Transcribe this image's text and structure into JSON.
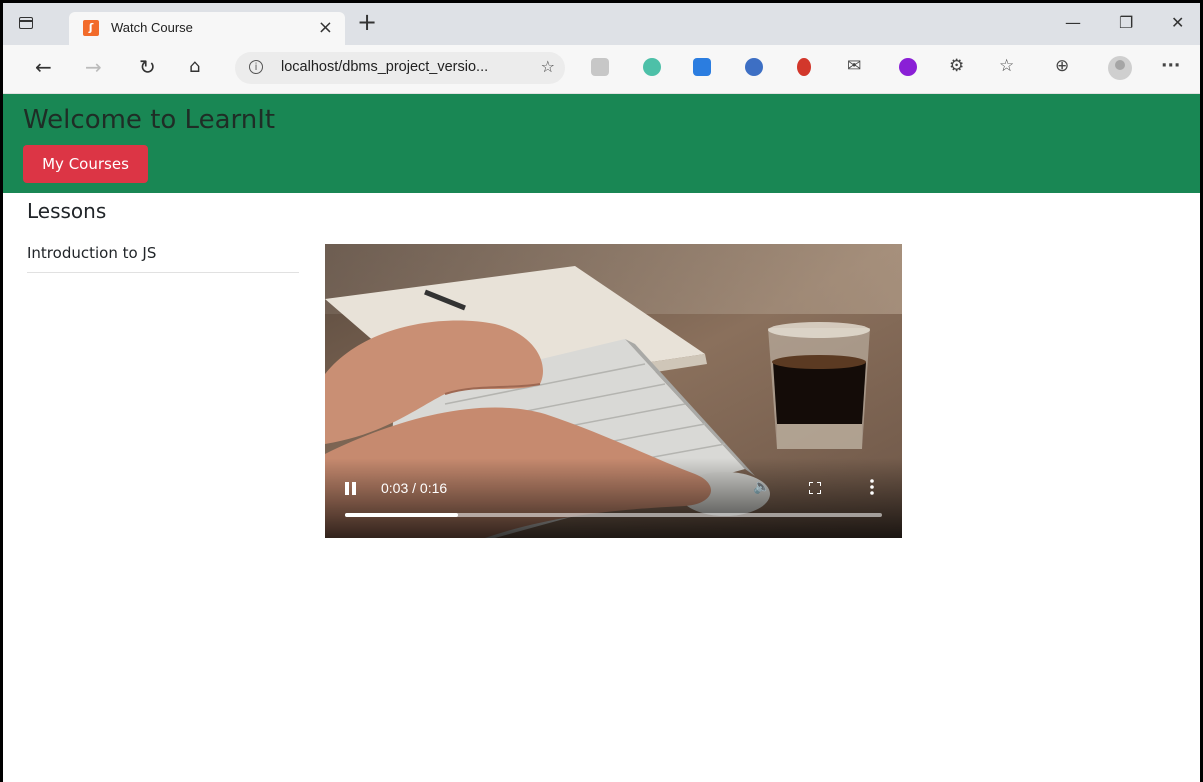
{
  "browser": {
    "tab_title": "Watch Course",
    "tab_close": "×",
    "new_tab": "+",
    "url": "localhost/dbms_project_versio...",
    "window_minimize": "—",
    "window_restore": "❐",
    "window_close": "✕"
  },
  "header": {
    "title": "Welcome to LearnIt",
    "my_courses_label": "My Courses",
    "background_color": "#198754",
    "button_color": "#dc3545"
  },
  "lessons": {
    "heading": "Lessons",
    "items": [
      {
        "label": "Introduction to JS"
      }
    ]
  },
  "video": {
    "time_display": "0:03 / 0:16",
    "progress_fraction": 0.21,
    "state": "playing"
  }
}
